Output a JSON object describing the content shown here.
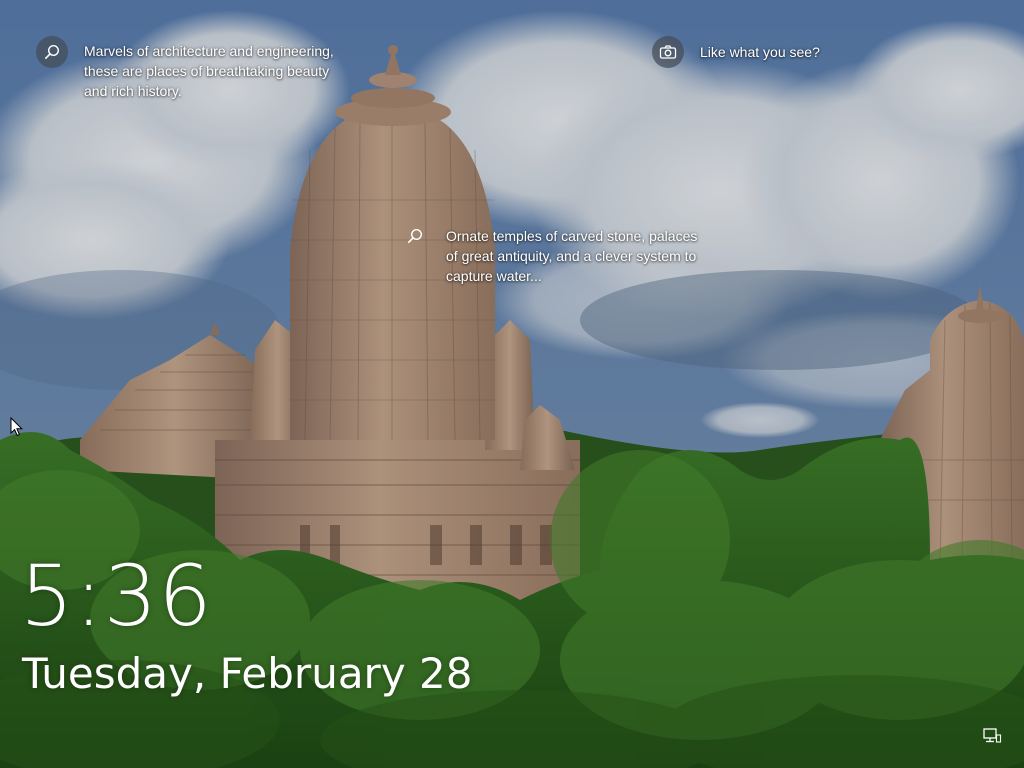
{
  "background": {
    "description_icon": "temple-landscape",
    "sky_color": "#5f7fa8",
    "foliage_color": "#2f6a22",
    "stone_color": "#b79479"
  },
  "spotlight": {
    "hotspot_1": {
      "icon": "search-icon",
      "text": "Marvels of architecture and engineering,\nthese are places of breathtaking beauty\nand rich history."
    },
    "hotspot_2": {
      "icon": "camera-icon",
      "text": "Like what you see?"
    },
    "hotspot_3": {
      "icon": "search-icon",
      "text": "Ornate temples of carved stone, palaces\nof great antiquity, and a clever system to\ncapture water..."
    }
  },
  "lock_screen": {
    "time": "5:36",
    "date": "Tuesday, February 28"
  },
  "status": {
    "network_icon": "network-icon"
  }
}
